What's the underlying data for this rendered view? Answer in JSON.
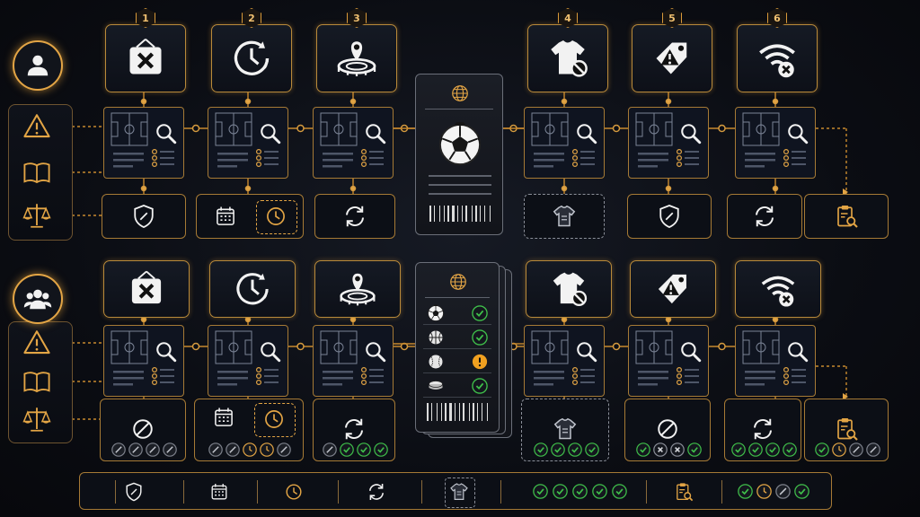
{
  "step_numbers": [
    "1",
    "2",
    "3",
    "4",
    "5",
    "6"
  ],
  "colors": {
    "accent": "#e3a545",
    "card_border": "#b98a3a",
    "check_green": "#3fbf4a",
    "warning_orange": "#f0a020",
    "background": "#0a0c12"
  },
  "top_row": {
    "step_icons": [
      "close-sign-icon",
      "clock-icon",
      "stadium-pin-icon",
      "jersey-blocked-icon",
      "warning-tag-icon",
      "wifi-off-icon"
    ],
    "status_icons": [
      "shield-icon",
      "calendar-clock-icon",
      "sync-icon",
      "jersey-icon",
      "shield-icon",
      "sync-icon",
      "clipboard-search-icon"
    ]
  },
  "bottom_row": {
    "step_icons": [
      "close-sign-icon",
      "clock-icon",
      "stadium-pin-icon",
      "jersey-blocked-icon",
      "warning-tag-icon",
      "wifi-off-icon"
    ],
    "status_icons": [
      "blocked-icon",
      "calendar-clock-icon",
      "sync-icon",
      "jersey-icon",
      "blocked-icon",
      "sync-icon",
      "clipboard-search-icon"
    ],
    "ticket_rows": [
      {
        "icon": "soccer-ball-icon",
        "status": "check"
      },
      {
        "icon": "basketball-icon",
        "status": "check"
      },
      {
        "icon": "baseball-icon",
        "status": "warning"
      },
      {
        "icon": "hockey-puck-icon",
        "status": "check"
      }
    ]
  },
  "sidebar_icons": [
    "warning-icon",
    "book-icon",
    "scales-icon"
  ],
  "summary_bar": [
    "shield-icon",
    "calendar-icon",
    "clock-icon",
    "sync-icon",
    "jersey-icon",
    "checks-icon",
    "clipboard-search-icon",
    "mixed-status-icon"
  ]
}
